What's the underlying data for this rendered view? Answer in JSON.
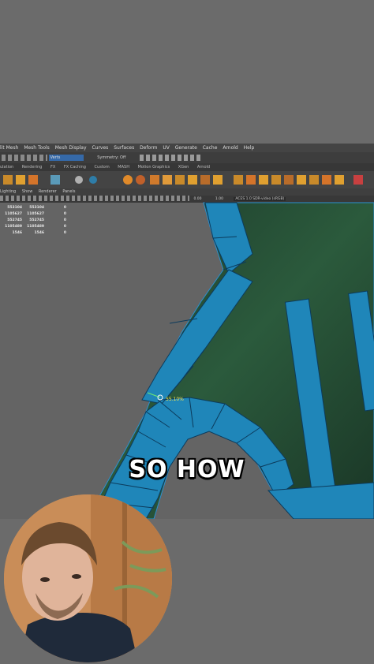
{
  "menubar": {
    "items": [
      "lit Mesh",
      "Mesh Tools",
      "Mesh Display",
      "Curves",
      "Surfaces",
      "Deform",
      "UV",
      "Generate",
      "Cache",
      "Arnold",
      "Help"
    ]
  },
  "statusline": {
    "search_value": "Verts",
    "symmetry": "Symmetry: Off"
  },
  "shelf_tabs": [
    "ulation",
    "Rendering",
    "FX",
    "FX Caching",
    "Custom",
    "MASH",
    "Motion Graphics",
    "XGen",
    "Arnold"
  ],
  "panel_menu": [
    "Lighting",
    "Show",
    "Renderer",
    "Panels"
  ],
  "panel_toolbar": {
    "near_value": "0.00",
    "scale_value": "1.00",
    "color_space": "ACES 1.0 SDR-video (sRGB)"
  },
  "hud_stats": [
    [
      "553104",
      "553104",
      "0"
    ],
    [
      "1105627",
      "1105627",
      "0"
    ],
    [
      "552745",
      "552745",
      "0"
    ],
    [
      "1105489",
      "1105489",
      "0"
    ],
    [
      "1546",
      "1546",
      "0"
    ]
  ],
  "slide_readout": "55.10%",
  "caption": "SO HOW",
  "colors": {
    "mesh_blue": "#1f86b9",
    "mesh_dark_green": "#1e3d2b",
    "viewport_bg": "#646464",
    "ui_dark": "#444444"
  }
}
